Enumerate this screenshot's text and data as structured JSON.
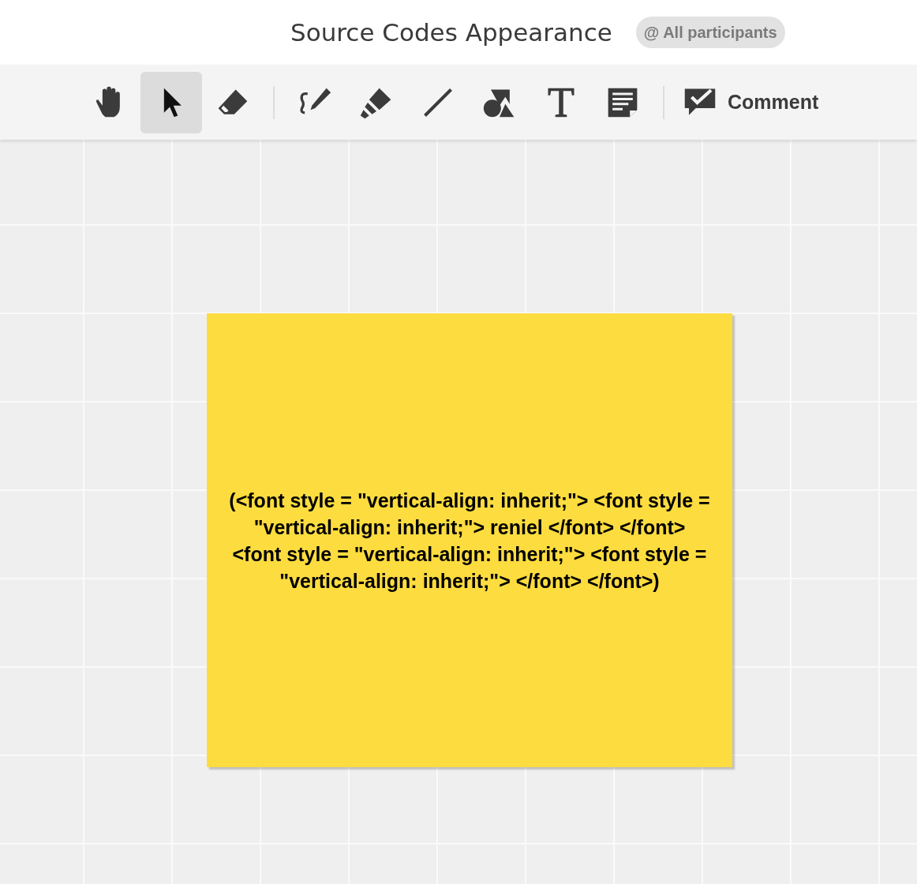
{
  "header": {
    "title": "Source Codes Appearance",
    "audience_badge": "@ All participants"
  },
  "toolbar": {
    "tool_groups": [
      [
        {
          "kind": "hand",
          "selected": false
        },
        {
          "kind": "pointer",
          "selected": true
        },
        {
          "kind": "eraser",
          "selected": false
        }
      ],
      [
        {
          "kind": "pen",
          "selected": false
        },
        {
          "kind": "highlighter",
          "selected": false
        },
        {
          "kind": "line",
          "selected": false
        },
        {
          "kind": "shapes",
          "selected": false
        },
        {
          "kind": "text",
          "selected": false
        },
        {
          "kind": "note",
          "selected": false
        }
      ]
    ],
    "comment_button": "Comment"
  },
  "sticky_note": {
    "color": "#fddc3f",
    "lines": [
      "(<font style = \"vertical-align: inherit;\"> <font style = \"vertical-align: inherit;\"> reniel </font> </font>",
      "<font style = \"vertical-align: inherit;\"> <font style = \"vertical-align: inherit;\"> </font> </font>)"
    ]
  }
}
